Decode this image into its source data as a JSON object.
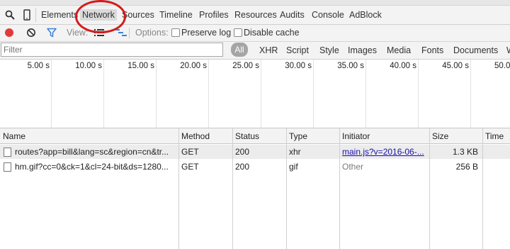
{
  "tabs": [
    {
      "label": "Elements"
    },
    {
      "label": "Network",
      "active": true
    },
    {
      "label": "Sources"
    },
    {
      "label": "Timeline"
    },
    {
      "label": "Profiles"
    },
    {
      "label": "Resources"
    },
    {
      "label": "Audits"
    },
    {
      "label": "Console"
    },
    {
      "label": "AdBlock"
    }
  ],
  "toolbar": {
    "view_label": "View:",
    "options_label": "Options:",
    "preserve_log": "Preserve log",
    "disable_cache": "Disable cache",
    "record_color": "#e03b3b",
    "filter_icon_color": "#3b82d6"
  },
  "filter": {
    "placeholder": "Filter",
    "all_label": "All",
    "types": [
      "XHR",
      "Script",
      "Style",
      "Images",
      "Media",
      "Fonts",
      "Documents",
      "W"
    ]
  },
  "overview": {
    "ticks": [
      "5.00 s",
      "10.00 s",
      "15.00 s",
      "20.00 s",
      "25.00 s",
      "30.00 s",
      "35.00 s",
      "40.00 s",
      "45.00 s",
      "50.0"
    ]
  },
  "table": {
    "columns": [
      "Name",
      "Method",
      "Status",
      "Type",
      "Initiator",
      "Size",
      "Time"
    ],
    "rows": [
      {
        "name": "routes?app=bill&lang=sc&region=cn&tr...",
        "method": "GET",
        "status": "200",
        "type": "xhr",
        "initiator": "main.js?v=2016-06-...",
        "initiator_is_link": true,
        "size": "1.3 KB"
      },
      {
        "name": "hm.gif?cc=0&ck=1&cl=24-bit&ds=1280...",
        "method": "GET",
        "status": "200",
        "type": "gif",
        "initiator": "Other",
        "initiator_is_link": false,
        "size": "256 B"
      }
    ]
  },
  "annotation_color": "#d41a1a"
}
